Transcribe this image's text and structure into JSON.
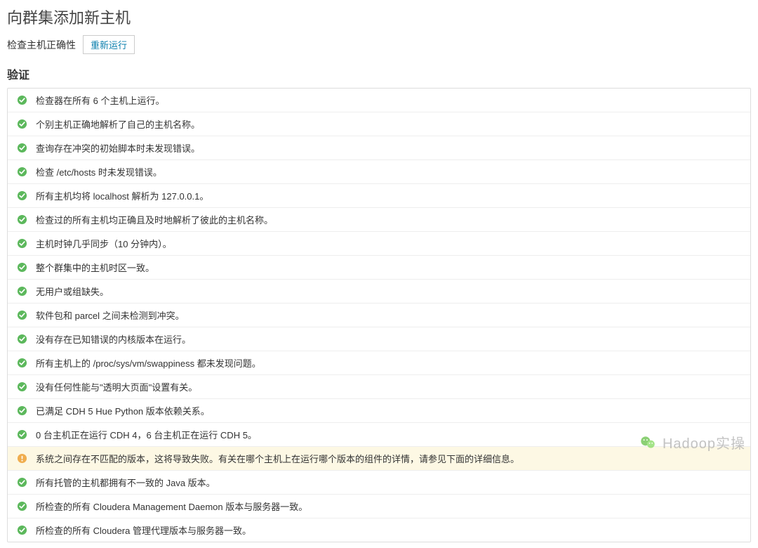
{
  "header": {
    "title": "向群集添加新主机",
    "subtitle": "检查主机正确性",
    "rerun_label": "重新运行"
  },
  "section": {
    "title": "验证"
  },
  "checks": [
    {
      "status": "ok",
      "text": "检查器在所有 6 个主机上运行。"
    },
    {
      "status": "ok",
      "text": "个别主机正确地解析了自己的主机名称。"
    },
    {
      "status": "ok",
      "text": "查询存在冲突的初始脚本时未发现错误。"
    },
    {
      "status": "ok",
      "text": "检查 /etc/hosts 时未发现错误。"
    },
    {
      "status": "ok",
      "text": "所有主机均将 localhost 解析为 127.0.0.1。"
    },
    {
      "status": "ok",
      "text": "检查过的所有主机均正确且及时地解析了彼此的主机名称。"
    },
    {
      "status": "ok",
      "text": "主机时钟几乎同步（10 分钟内）。"
    },
    {
      "status": "ok",
      "text": "整个群集中的主机时区一致。"
    },
    {
      "status": "ok",
      "text": "无用户或组缺失。"
    },
    {
      "status": "ok",
      "text": "软件包和 parcel 之间未检测到冲突。"
    },
    {
      "status": "ok",
      "text": "没有存在已知错误的内核版本在运行。"
    },
    {
      "status": "ok",
      "text": "所有主机上的 /proc/sys/vm/swappiness 都未发现问题。"
    },
    {
      "status": "ok",
      "text": "没有任何性能与\"透明大页面\"设置有关。"
    },
    {
      "status": "ok",
      "text": "已满足 CDH 5 Hue Python 版本依赖关系。"
    },
    {
      "status": "ok",
      "text": "0 台主机正在运行 CDH 4，6 台主机正在运行 CDH 5。"
    },
    {
      "status": "warn",
      "text": "系统之间存在不匹配的版本，这将导致失败。有关在哪个主机上在运行哪个版本的组件的详情，请参见下面的详细信息。"
    },
    {
      "status": "ok",
      "text": "所有托管的主机都拥有不一致的 Java 版本。"
    },
    {
      "status": "ok",
      "text": "所检查的所有 Cloudera Management Daemon 版本与服务器一致。"
    },
    {
      "status": "ok",
      "text": "所检查的所有 Cloudera 管理代理版本与服务器一致。"
    }
  ],
  "watermark": {
    "text": "Hadoop实操"
  }
}
